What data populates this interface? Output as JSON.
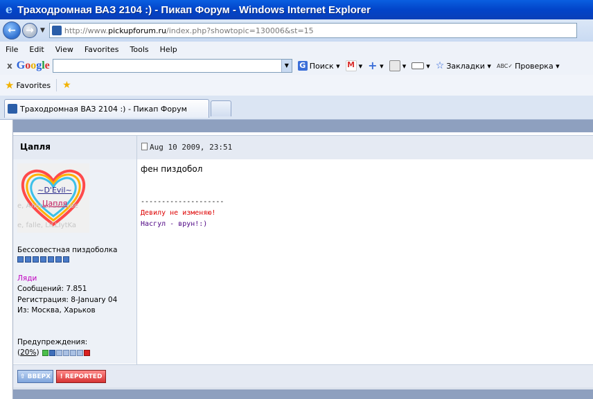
{
  "window": {
    "title": "Траходромная ВАЗ 2104 :) - Пикап Форум - Windows Internet Explorer"
  },
  "address": {
    "url_prefix": "http://www.",
    "url_host": "pickupforum.ru",
    "url_path": "/index.php?showtopic=130006&st=15"
  },
  "menu": [
    "File",
    "Edit",
    "View",
    "Favorites",
    "Tools",
    "Help"
  ],
  "google": {
    "close": "x",
    "logo": [
      "G",
      "o",
      "o",
      "g",
      "l",
      "e"
    ],
    "search_label": "Поиск",
    "bookmarks_label": "Закладки",
    "check_label": "Проверка"
  },
  "favorites": {
    "label": "Favorites"
  },
  "tab": {
    "title": "Траходромная ВАЗ 2104 :) - Пикап Форум"
  },
  "post": {
    "author": "Цапля",
    "date": "Aug 10 2009, 23:51",
    "avatar_nick": "~D'Evil~",
    "avatar_name": "Цапля",
    "avatar_ghost": "е, Алёна, Sankde",
    "avatar_ghost2": "е, falle, LiLLIytKa",
    "rank": "Бессовестная пиздоболка",
    "rank_pips": 7,
    "group": "Ляди",
    "posts": "Сообщений: 7.851",
    "registered": "Регистрация: 8-January 04",
    "from": "Из: Москва, Харьков",
    "warnings_label": "Предупреждения:",
    "warn_open": "(",
    "warn_pct": "20%",
    "warn_close": ")",
    "body": "фен пиздобол",
    "sig_separator": "--------------------",
    "sig_line1": "Девилу не изменяю!",
    "sig_line2": "Насгул - врун!:)"
  },
  "buttons": {
    "top": "ВВЕРХ",
    "report": "REPORTED"
  },
  "colors": {
    "titlebar": "#0244c9",
    "forum_strip": "#8ea0bf",
    "sig_red": "#dd0000",
    "sig_purple": "#4b0082",
    "group_color": "#c000c0"
  }
}
